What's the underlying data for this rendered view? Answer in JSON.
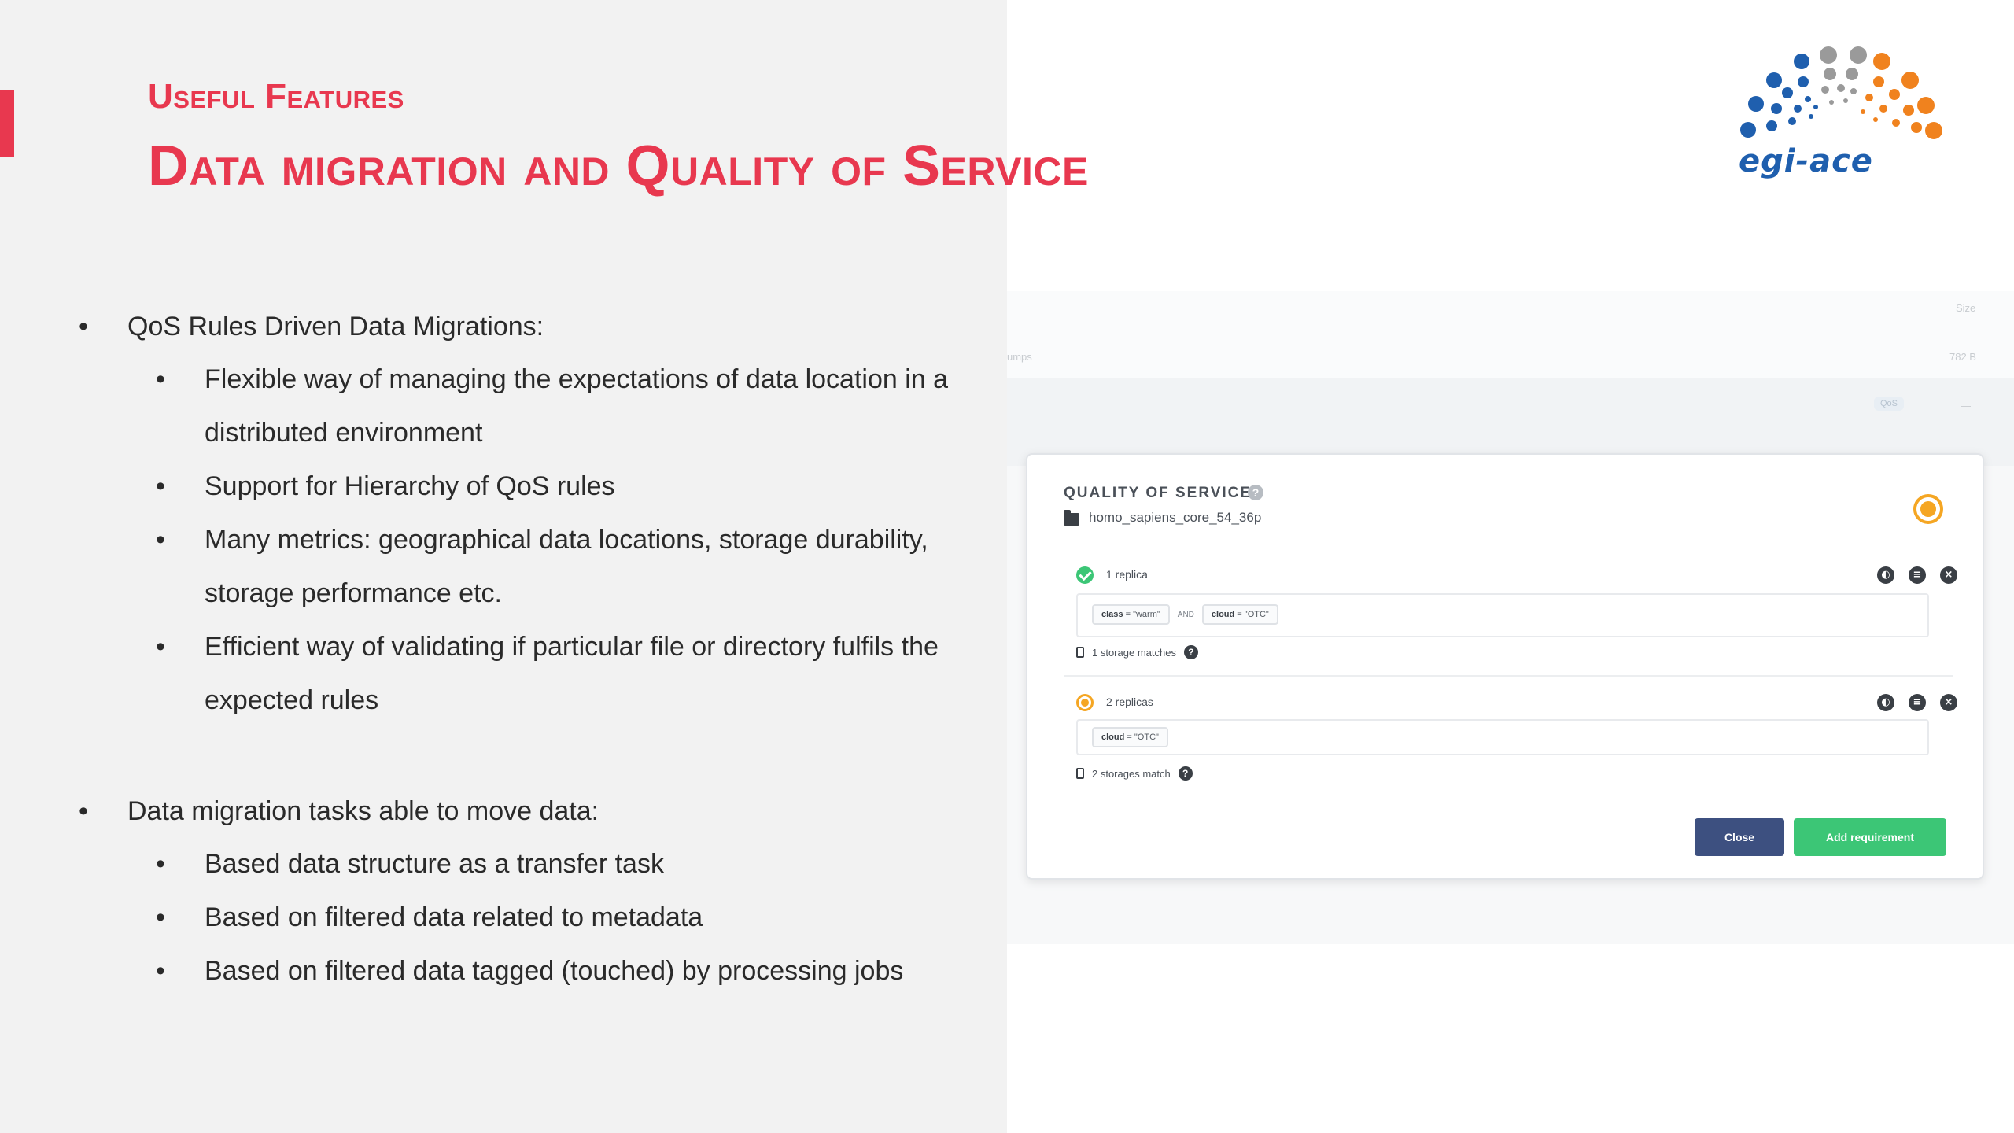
{
  "slide": {
    "subtitle": "Useful Features",
    "title": "Data migration and Quality of Service"
  },
  "bullets": {
    "group1": {
      "heading": "QoS Rules Driven Data Migrations:",
      "items": [
        "Flexible way of managing the expectations of data location in a distributed environment",
        "Support for Hierarchy of QoS rules",
        "Many metrics: geographical data locations, storage durability, storage performance  etc.",
        "Efficient way of validating if particular file or directory fulfils the expected rules"
      ]
    },
    "group2": {
      "heading": "Data migration tasks  able to move data:",
      "items": [
        "Based data structure as a transfer task",
        "Based on filtered data related to metadata",
        "Based on filtered data tagged (touched)  by processing jobs"
      ]
    }
  },
  "logo": {
    "text": "egi-ace",
    "colors": {
      "blue": "#1f5fae",
      "grey": "#9a9a9a",
      "orange": "#f0821e"
    }
  },
  "background_table": {
    "size_header": "Size",
    "row1_name": "umps",
    "row1_size": "782 B",
    "row2_badge": "QoS",
    "row2_dash": "—"
  },
  "modal": {
    "title": "QUALITY OF SERVICE",
    "help_icon": "?",
    "path": "homo_sapiens_core_54_36p",
    "requirements": [
      {
        "status": "fulfilled",
        "label": "1 replica",
        "tokens": [
          {
            "key": "class",
            "value": "\"warm\""
          },
          {
            "key": "cloud",
            "value": "\"OTC\""
          }
        ],
        "operator": "AND",
        "storage_text": "1 storage matches"
      },
      {
        "status": "pending",
        "label": "2 replicas",
        "tokens": [
          {
            "key": "cloud",
            "value": "\"OTC\""
          }
        ],
        "storage_text": "2 storages match"
      }
    ],
    "buttons": {
      "close": "Close",
      "add": "Add requirement"
    }
  },
  "colors": {
    "accent_red": "#e8384f",
    "success_green": "#3cc676",
    "pending_orange": "#f5a623",
    "close_button": "#3d5080"
  }
}
